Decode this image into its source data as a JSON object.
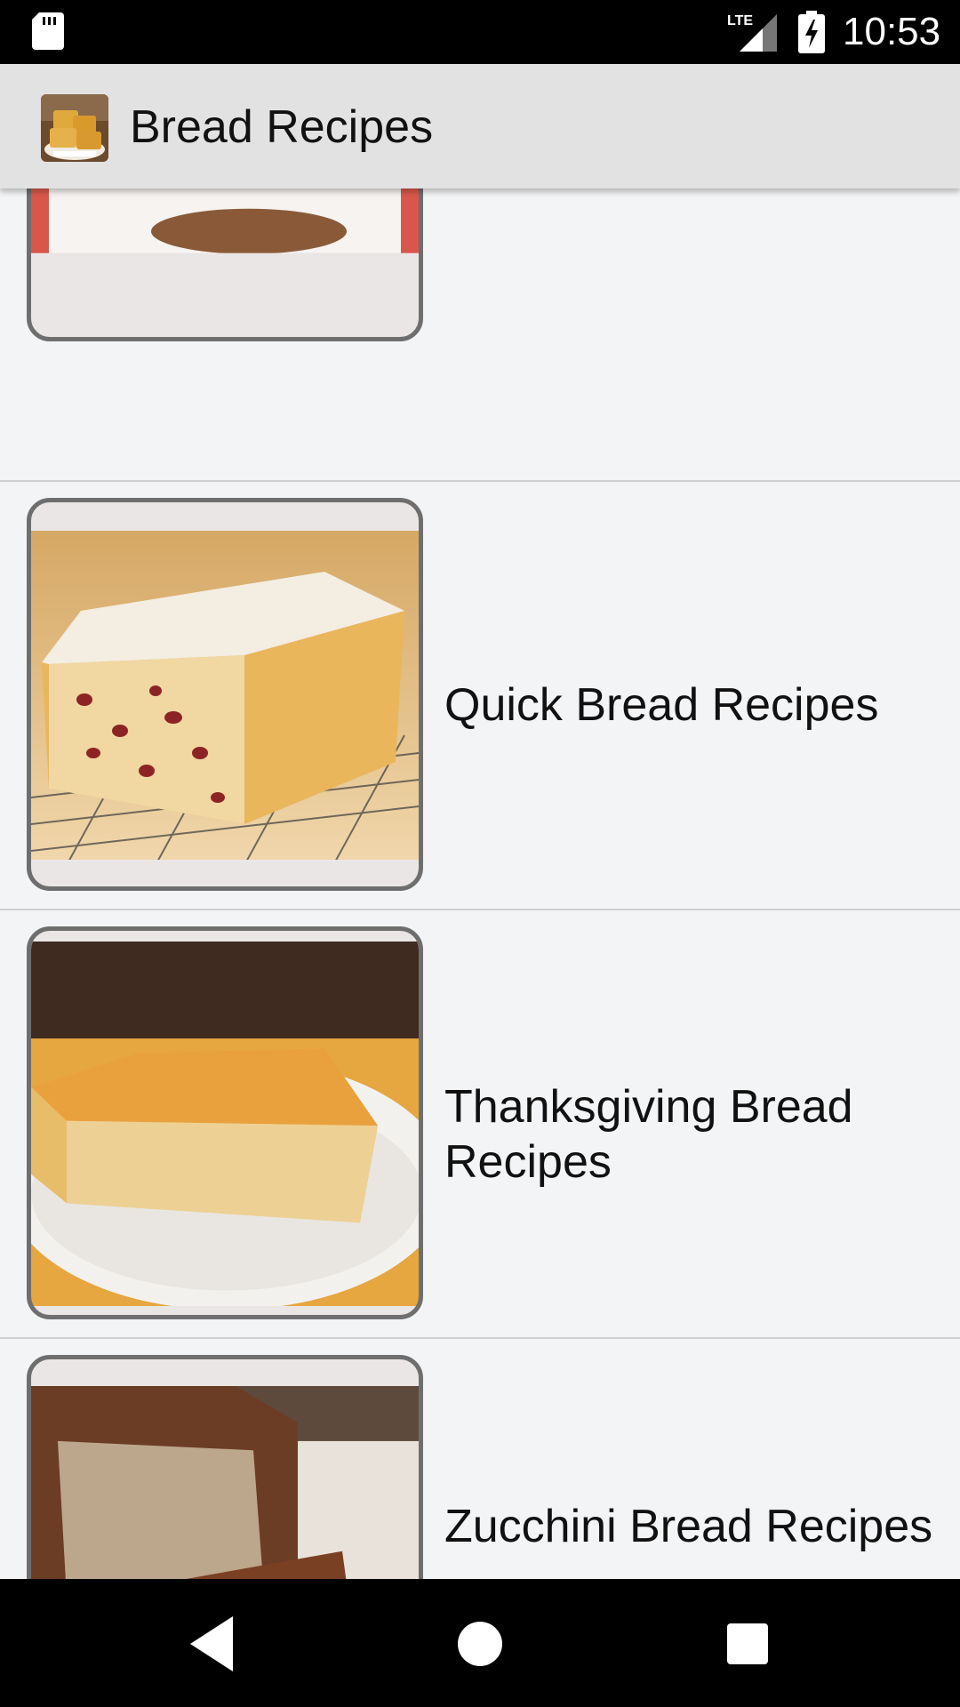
{
  "status_bar": {
    "network": "LTE",
    "time": "10:53"
  },
  "app_bar": {
    "title": "Bread Recipes",
    "icon": "bread-app-icon"
  },
  "recipes": [
    {
      "label": "",
      "image": "bread-loaf-on-plate"
    },
    {
      "label": "Quick Bread Recipes",
      "image": "almond-fruit-loaf"
    },
    {
      "label": "Thanksgiving Bread Recipes",
      "image": "cornbread-slice"
    },
    {
      "label": "Zucchini Bread Recipes",
      "image": "zucchini-bread-slices"
    }
  ],
  "nav_bar": {
    "back": "back-icon",
    "home": "home-icon",
    "recents": "recents-icon"
  },
  "colors": {
    "status_bar": "#000000",
    "app_bar": "#e2e2e2",
    "list_background": "#f3f4f6",
    "card_border": "#6e6e6e"
  }
}
